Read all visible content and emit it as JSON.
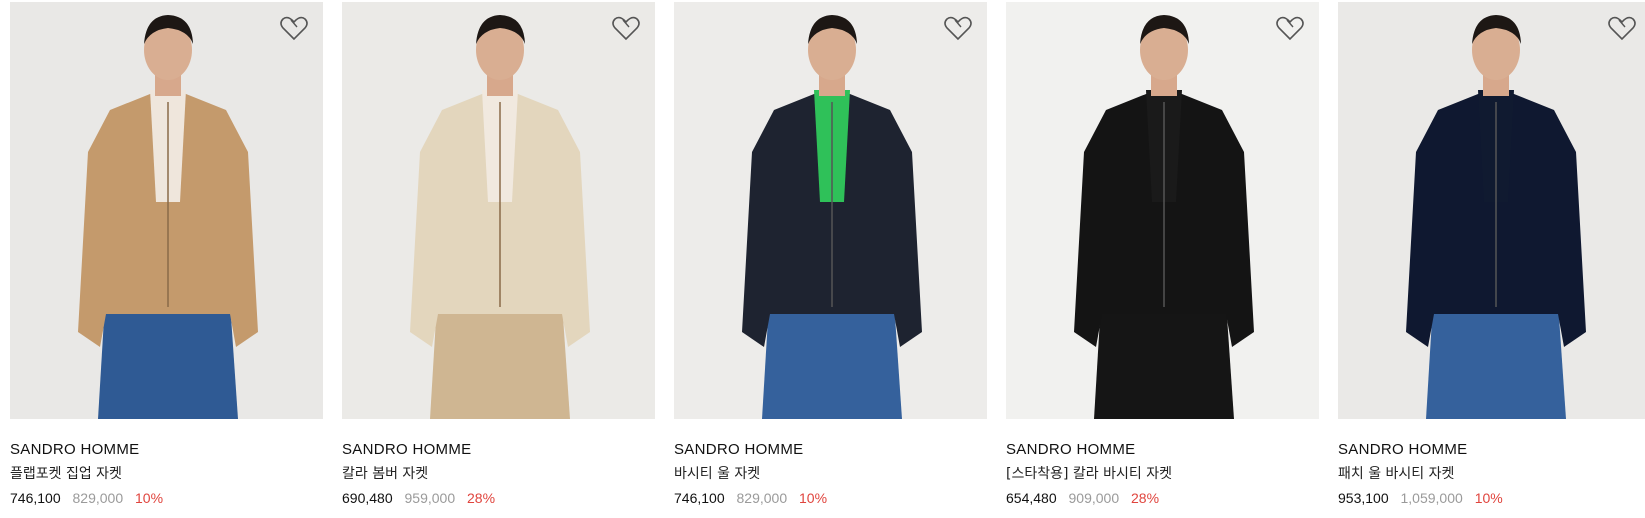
{
  "products": [
    {
      "brand": "SANDRO HOMME",
      "name": "플랩포켓 집업 자켓",
      "price": "746,100",
      "original_price": "829,000",
      "discount": "10%",
      "jacket_color": "#c49a6c",
      "shirt_color": "#efe6dc",
      "pants_color": "#2f5a94",
      "bg_color": "#e9e8e6"
    },
    {
      "brand": "SANDRO HOMME",
      "name": "칼라 봄버 자켓",
      "price": "690,480",
      "original_price": "959,000",
      "discount": "28%",
      "jacket_color": "#e3d6bd",
      "shirt_color": "#f1e9df",
      "pants_color": "#cfb692",
      "bg_color": "#ebeae7"
    },
    {
      "brand": "SANDRO HOMME",
      "name": "바시티 울 자켓",
      "price": "746,100",
      "original_price": "829,000",
      "discount": "10%",
      "jacket_color": "#1e2330",
      "shirt_color": "#2fc159",
      "pants_color": "#35619c",
      "bg_color": "#edecea"
    },
    {
      "brand": "SANDRO HOMME",
      "name": "[스타착용] 칼라 바시티 자켓",
      "price": "654,480",
      "original_price": "909,000",
      "discount": "28%",
      "jacket_color": "#141414",
      "shirt_color": "#1a1a1a",
      "pants_color": "#151515",
      "bg_color": "#f1f1ef"
    },
    {
      "brand": "SANDRO HOMME",
      "name": "패치 울 바시티 자켓",
      "price": "953,100",
      "original_price": "1,059,000",
      "discount": "10%",
      "jacket_color": "#0f1830",
      "shirt_color": "#101a30",
      "pants_color": "#35619c",
      "bg_color": "#eae9e7"
    }
  ],
  "icons": {
    "wishlist": "heart-icon"
  },
  "colors": {
    "discount": "#e0443d",
    "original_price": "#9a9a9a"
  }
}
